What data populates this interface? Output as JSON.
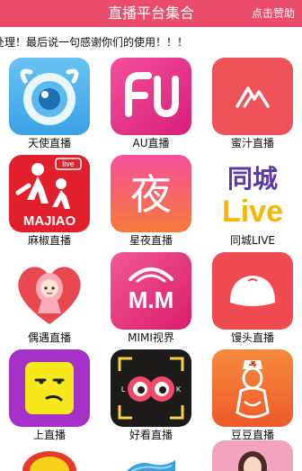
{
  "header": {
    "title": "直播平台集合",
    "donate_label": "点击赞助"
  },
  "marquee": {
    "text": "处理！最后说一句感谢你们的使用！！！"
  },
  "apps": [
    {
      "name": "天使直播",
      "icon": "camera-lens-icon"
    },
    {
      "name": "AU直播",
      "icon": "au-logo-icon"
    },
    {
      "name": "蜜汁直播",
      "icon": "mountain-m-icon"
    },
    {
      "name": "麻椒直播",
      "icon": "majiao-parent-child-icon",
      "icon_text": [
        "live",
        "MAJIAO"
      ]
    },
    {
      "name": "星夜直播",
      "icon": "night-character-icon",
      "icon_text": [
        "夜"
      ]
    },
    {
      "name": "同城LIVE",
      "icon": "tongcheng-live-icon",
      "icon_text": [
        "同城",
        "Live"
      ]
    },
    {
      "name": "偶遇直播",
      "icon": "girl-heart-icon"
    },
    {
      "name": "MIMI视界",
      "icon": "mm-logo-icon",
      "icon_text": [
        "M.M"
      ]
    },
    {
      "name": "馒头直播",
      "icon": "bun-icon"
    },
    {
      "name": "上直播",
      "icon": "smirk-face-icon"
    },
    {
      "name": "好看直播",
      "icon": "eyes-icon",
      "icon_text": [
        "L",
        "K"
      ]
    },
    {
      "name": "豆豆直播",
      "icon": "nurse-silhouette-icon"
    }
  ],
  "colors": {
    "header": "#ec4c6c",
    "background": "#ffffff"
  }
}
